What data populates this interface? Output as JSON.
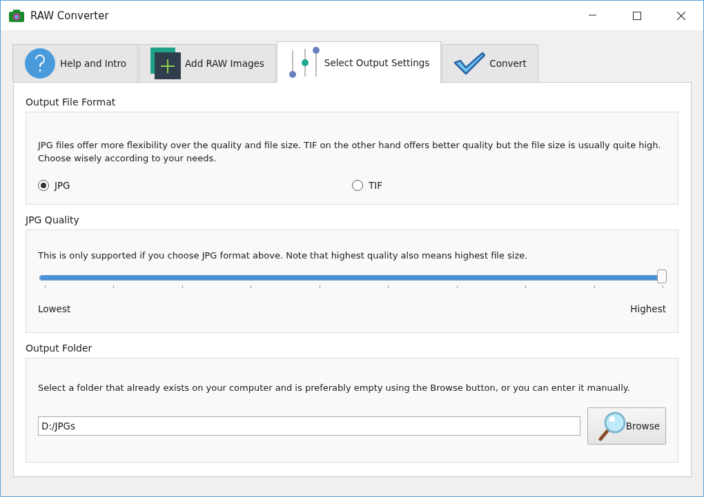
{
  "window": {
    "title": "RAW Converter"
  },
  "tabs": [
    {
      "label": "Help and Intro",
      "kind": "help",
      "selected": false
    },
    {
      "label": "Add RAW Images",
      "kind": "add",
      "selected": false
    },
    {
      "label": "Select Output Settings",
      "kind": "sliders",
      "selected": true
    },
    {
      "label": "Convert",
      "kind": "check",
      "selected": false
    }
  ],
  "format_section": {
    "title": "Output File Format",
    "description": "JPG files offer more flexibility over the quality and file size. TIF on the other hand offers better quality but the file size is usually quite high. Choose wisely according to your needs.",
    "options": [
      {
        "label": "JPG",
        "selected": true
      },
      {
        "label": "TIF",
        "selected": false
      }
    ]
  },
  "quality_section": {
    "title": "JPG Quality",
    "description": "This is only supported if you choose JPG format above. Note that highest quality also means highest file size.",
    "slider": {
      "level": 1.0,
      "min_label": "Lowest",
      "max_label": "Highest"
    }
  },
  "folder_section": {
    "title": "Output Folder",
    "description": "Select a folder that already exists on your computer and is preferably empty using the Browse button, or you can enter it manually.",
    "path": "D:/JPGs",
    "browse_button": "Browse"
  }
}
